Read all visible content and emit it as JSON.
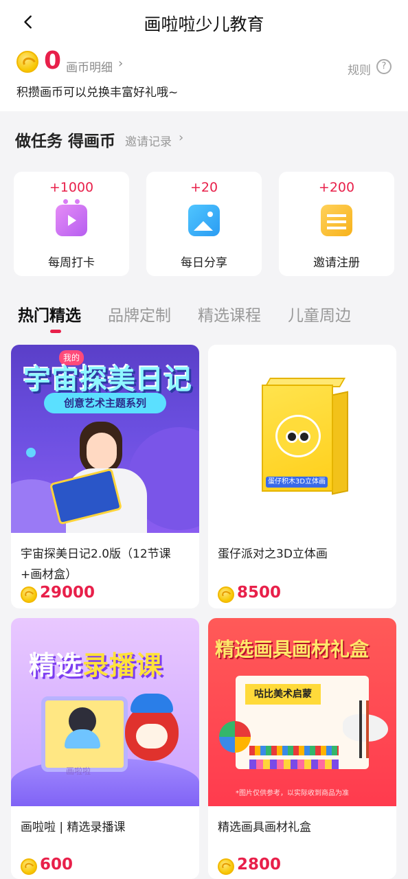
{
  "header": {
    "title": "画啦啦少儿教育",
    "back_icon": "chevron-left-icon"
  },
  "coins": {
    "balance": "0",
    "detail_label": "画币明细",
    "detail_arrow": "›",
    "rules_label": "规则",
    "rules_icon_glyph": "?",
    "tip": "积攒画币可以兑换丰富好礼哦~",
    "coin_icon": "coin-icon"
  },
  "tasks": {
    "title": "做任务 得画币",
    "invite_record_label": "邀请记录",
    "invite_record_arrow": "›",
    "items": [
      {
        "points": "+1000",
        "label": "每周打卡",
        "icon": "tv-icon"
      },
      {
        "points": "+20",
        "label": "每日分享",
        "icon": "image-icon"
      },
      {
        "points": "+200",
        "label": "邀请注册",
        "icon": "note-icon"
      }
    ]
  },
  "tabs": [
    {
      "label": "热门精选",
      "active": true
    },
    {
      "label": "品牌定制",
      "active": false
    },
    {
      "label": "精选课程",
      "active": false
    },
    {
      "label": "儿童周边",
      "active": false
    }
  ],
  "products": [
    {
      "name": "宇宙探美日记2.0版（12节课+画材盒）",
      "price": "29000",
      "image": {
        "badge": "我的",
        "title": "宇宙探美日记",
        "subtitle": "创意艺术主题系列"
      }
    },
    {
      "name": "蛋仔派对之3D立体画",
      "price": "8500",
      "image": {
        "label": "蛋仔积木3D立体画"
      }
    },
    {
      "name": "画啦啦 | 精选录播课",
      "price": "600",
      "image": {
        "title_part1": "精选",
        "title_part2": "录播课",
        "screen_label": "画啦啦"
      }
    },
    {
      "name": "精选画具画材礼盒",
      "price": "2800",
      "image": {
        "title": "精选画具画材礼盒",
        "kit_title": "咕比美术启蒙",
        "note": "*图片仅供参考，以实际收到商品为准"
      }
    }
  ],
  "colors": {
    "accent": "#e8204a",
    "coin": "#f7c600",
    "background": "#f4f4f6"
  }
}
